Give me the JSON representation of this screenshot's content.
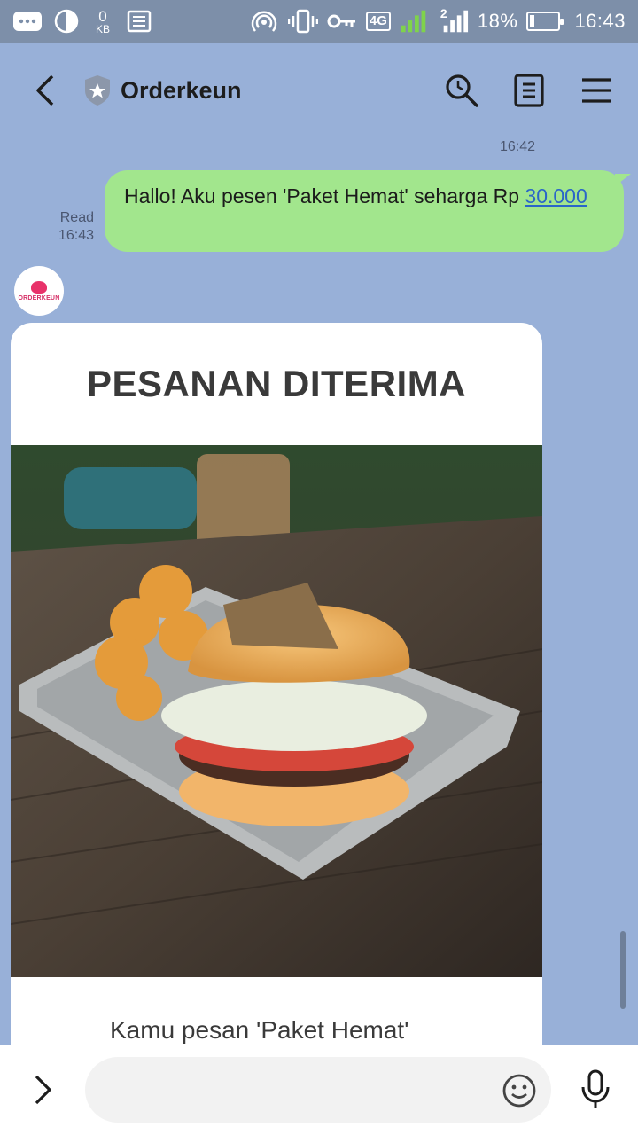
{
  "status_bar": {
    "data_amount": "0",
    "data_unit": "KB",
    "network_type": "4G",
    "sim2_label": "2",
    "battery_percent": "18%",
    "battery_level": 0.18,
    "time": "16:43"
  },
  "header": {
    "title": "Orderkeun"
  },
  "chat": {
    "sent_time": "16:42",
    "sent_message_text": "Hallo! Aku pesen 'Paket Hemat' seharga Rp ",
    "sent_message_price": "30.000",
    "read_status": "Read",
    "read_time": "16:43",
    "bot_avatar_text": "ORDERKEUN",
    "card": {
      "title": "PESANAN DITERIMA",
      "description": "Kamu pesan 'Paket Hemat'"
    }
  },
  "input_bar": {
    "placeholder": ""
  },
  "colors": {
    "chat_background": "#98b0d8",
    "sent_bubble": "#a2e68d",
    "link": "#2a66c8",
    "brand": "#e8326a"
  }
}
